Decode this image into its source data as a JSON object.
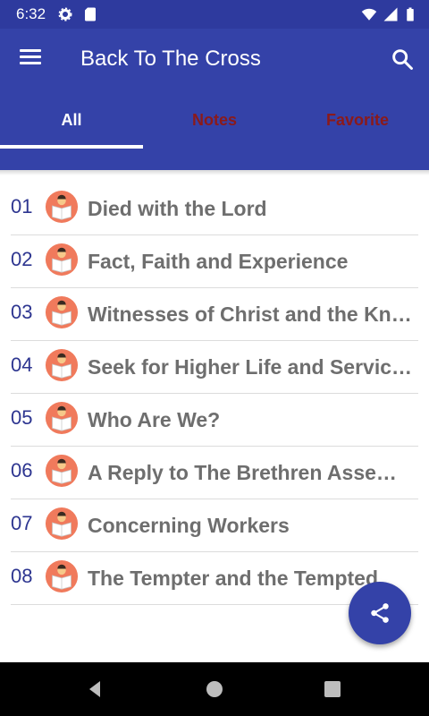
{
  "status_bar": {
    "time": "6:32"
  },
  "app_bar": {
    "title": "Back To The Cross"
  },
  "tabs": [
    {
      "label": "All",
      "selected": true
    },
    {
      "label": "Notes",
      "selected": false
    },
    {
      "label": "Favorite",
      "selected": false
    }
  ],
  "items": [
    {
      "number": "01",
      "title": "Died with the Lord"
    },
    {
      "number": "02",
      "title": "Fact, Faith and Experience"
    },
    {
      "number": "03",
      "title": "Witnesses of Christ and the Kn…"
    },
    {
      "number": "04",
      "title": "Seek for Higher Life and Servic…"
    },
    {
      "number": "05",
      "title": "Who Are We?"
    },
    {
      "number": "06",
      "title": "A Reply to The Brethren Asse…"
    },
    {
      "number": "07",
      "title": "Concerning Workers"
    },
    {
      "number": "08",
      "title": "The Tempter and the Tempted"
    }
  ],
  "colors": {
    "primary": "#3442a8",
    "tab_inactive": "#8b1a1a",
    "number": "#2d3590",
    "icon_bg": "#f07a5c"
  }
}
